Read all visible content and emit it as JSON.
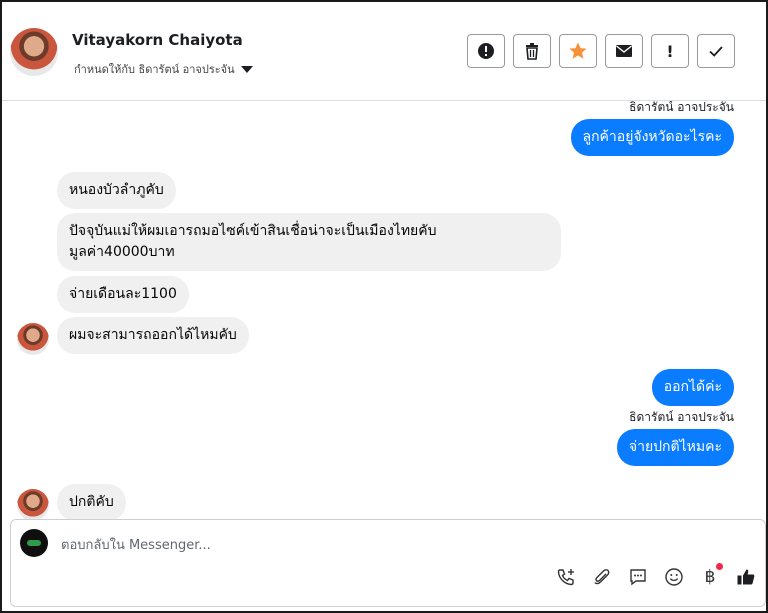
{
  "header": {
    "contact_name": "Vitayakorn Chaiyota",
    "assign_label": "กำหนดให้กับ ธิดารัตน์ อาจประจัน",
    "actions": [
      {
        "icon": "alert-circle-icon"
      },
      {
        "icon": "trash-icon"
      },
      {
        "icon": "star-icon",
        "color": "#f7923a"
      },
      {
        "icon": "envelope-icon"
      },
      {
        "icon": "exclamation-icon",
        "text": "!"
      },
      {
        "icon": "check-icon"
      }
    ]
  },
  "messages": {
    "m1": {
      "sender": "ธิดารัตน์ อาจประจัน",
      "text": "ลูกค้าอยู่จังหวัดอะไรคะ"
    },
    "m2": {
      "text": "หนองบัวลำภูคับ"
    },
    "m3": {
      "line1": "ปัจจุบันแม่ให้ผมเอารถมอไซค์เข้าสินเชื่อน่าจะเป็นเมืองไทยคับ",
      "line2": "มูลค่า40000บาท"
    },
    "m4": {
      "text": "จ่ายเดือนละ1100"
    },
    "m5": {
      "text": "ผมจะสามารถออกได้ไหมคับ"
    },
    "m6": {
      "text": "ออกได้ค่ะ"
    },
    "m7": {
      "sender": "ธิดารัตน์ อาจประจัน",
      "text": "จ่ายปกติไหมคะ"
    },
    "m8": {
      "text": "ปกติคับ"
    }
  },
  "composer": {
    "placeholder": "ตอบกลับใน Messenger...",
    "tools": [
      "phone-plus-icon",
      "paperclip-icon",
      "chat-icon",
      "emoji-icon",
      "baht-icon",
      "thumbs-up-icon"
    ],
    "baht_symbol": "฿"
  },
  "colors": {
    "outgoing_bubble": "#0a7cff",
    "incoming_bubble": "#f0f0f0",
    "star": "#f7923a",
    "notification_dot": "#f02849"
  }
}
